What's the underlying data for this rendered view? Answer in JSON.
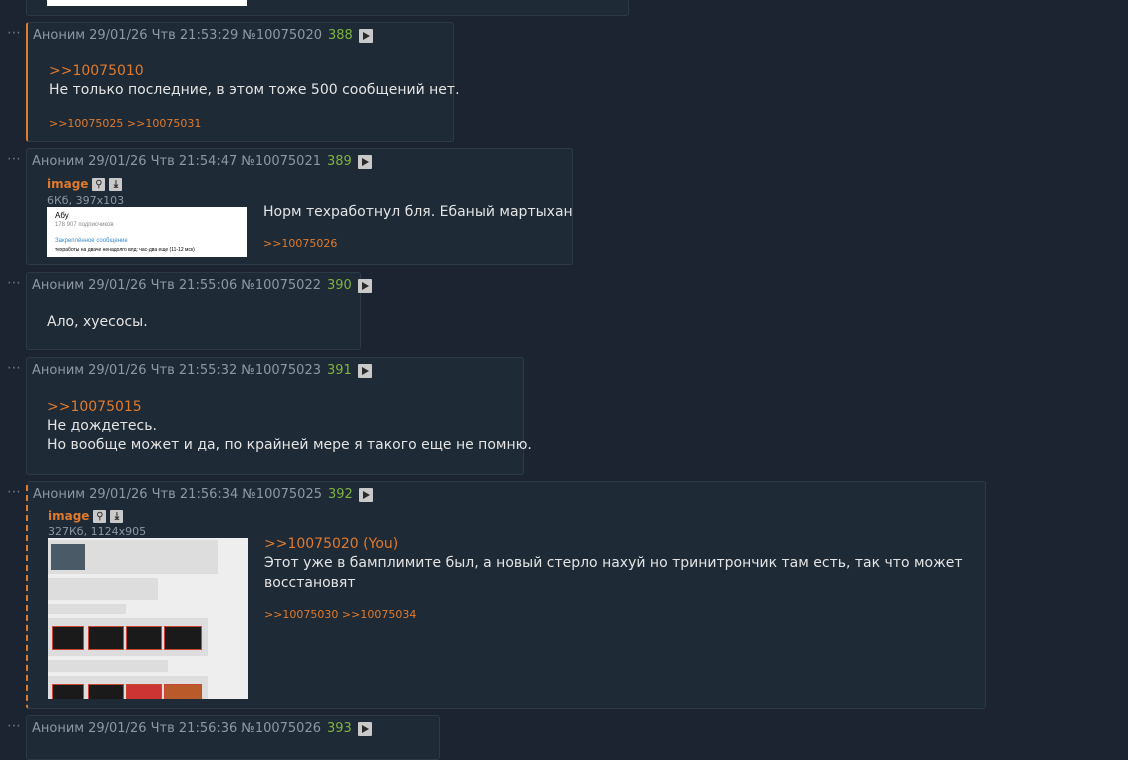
{
  "top_image_fragment": true,
  "posts": [
    {
      "author": "Аноним",
      "datetime": "29/01/26 Чтв 21:53:29",
      "id": "№10075020",
      "num": "388",
      "quote": ">>10075010",
      "lines": [
        "Не только последние, в этом тоже 500 сообщений нет."
      ],
      "replies": ">>10075025 >>10075031"
    },
    {
      "author": "Аноним",
      "datetime": "29/01/26 Чтв 21:54:47",
      "id": "№10075021",
      "num": "389",
      "file_label": "image",
      "file_info": "6Кб, 397x103",
      "thumb": {
        "name": "Абу",
        "subs": "178 907 подписчиков",
        "pinned": "Закреплённое сообщение",
        "msg": "техработы на двачe ненадолго  влд: час-два еще (11-12 мск)"
      },
      "lines": [
        "Норм техработнул бля. Ебаный мартыхан"
      ],
      "replies": ">>10075026"
    },
    {
      "author": "Аноним",
      "datetime": "29/01/26 Чтв 21:55:06",
      "id": "№10075022",
      "num": "390",
      "lines": [
        "Ало, хуесосы."
      ]
    },
    {
      "author": "Аноним",
      "datetime": "29/01/26 Чтв 21:55:32",
      "id": "№10075023",
      "num": "391",
      "quote": ">>10075015",
      "lines": [
        "Не дождетесь.",
        "Но вообще может и да, по крайней мере я такого еще не помню."
      ]
    },
    {
      "author": "Аноним",
      "datetime": "29/01/26 Чтв 21:56:34",
      "id": "№10075025",
      "num": "392",
      "file_label": "image",
      "file_info": "327Кб, 1124x905",
      "quote": ">>10075020 (You)",
      "lines": [
        "Этот уже в бамплимите был, а новый стерло нахуй но тринитрончик там есть, так что может",
        "восстановят"
      ],
      "replies": ">>10075030 >>10075034"
    },
    {
      "author": "Аноним",
      "datetime": "29/01/26 Чтв 21:56:36",
      "id": "№10075026",
      "num": "393"
    }
  ],
  "colors": {
    "accent": "#e07a2c",
    "num": "#7fb33e",
    "bg": "#1b2430",
    "post_bg": "#1e2a36"
  },
  "icons": {
    "dots": "ellipsis-icon",
    "play": "play-icon",
    "search": "search-icon",
    "download": "download-icon"
  },
  "dots_glyph": "⋯"
}
